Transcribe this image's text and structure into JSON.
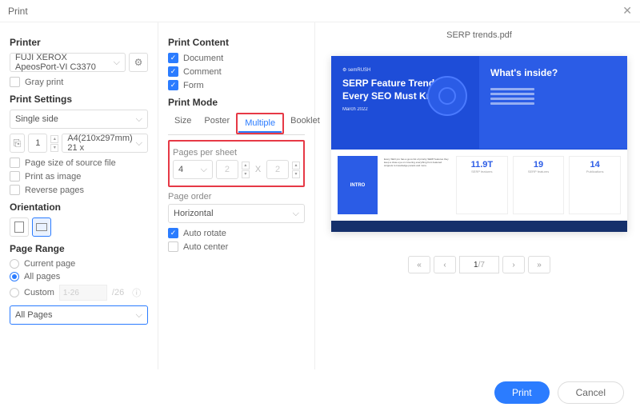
{
  "titlebar": {
    "title": "Print"
  },
  "printer": {
    "section": "Printer",
    "selected": "FUJI XEROX ApeosPort-VI C3370",
    "gray_print": "Gray print"
  },
  "settings": {
    "section": "Print Settings",
    "side": "Single side",
    "copies": "1",
    "paper": "A4(210x297mm) 21 x",
    "source_file": "Page size of source file",
    "as_image": "Print as image",
    "reverse": "Reverse pages"
  },
  "orientation": {
    "section": "Orientation"
  },
  "range": {
    "section": "Page Range",
    "current": "Current page",
    "all": "All pages",
    "custom": "Custom",
    "custom_hint": "1-26",
    "total": "/26",
    "filter": "All Pages"
  },
  "content": {
    "section": "Print Content",
    "document": "Document",
    "comment": "Comment",
    "form": "Form"
  },
  "mode": {
    "section": "Print Mode",
    "tabs": {
      "size": "Size",
      "poster": "Poster",
      "multiple": "Multiple",
      "booklet": "Booklet"
    },
    "pps_label": "Pages per sheet",
    "pps_value": "4",
    "cols": "2",
    "rows": "2",
    "order_label": "Page order",
    "order": "Horizontal",
    "auto_rotate": "Auto rotate",
    "auto_center": "Auto center"
  },
  "preview": {
    "filename": "SERP trends.pdf",
    "slide1": {
      "title": "SERP Feature Trends Every SEO Must Know",
      "date": "March 2022"
    },
    "slide2": {
      "title": "What's inside?"
    },
    "intro": "INTRO",
    "stats": [
      {
        "n": "11.9T",
        "l": "SERP features"
      },
      {
        "n": "19",
        "l": "SERP features"
      },
      {
        "n": "14",
        "l": "Publications"
      }
    ],
    "page": "1",
    "total": "/7"
  },
  "buttons": {
    "print": "Print",
    "cancel": "Cancel"
  }
}
